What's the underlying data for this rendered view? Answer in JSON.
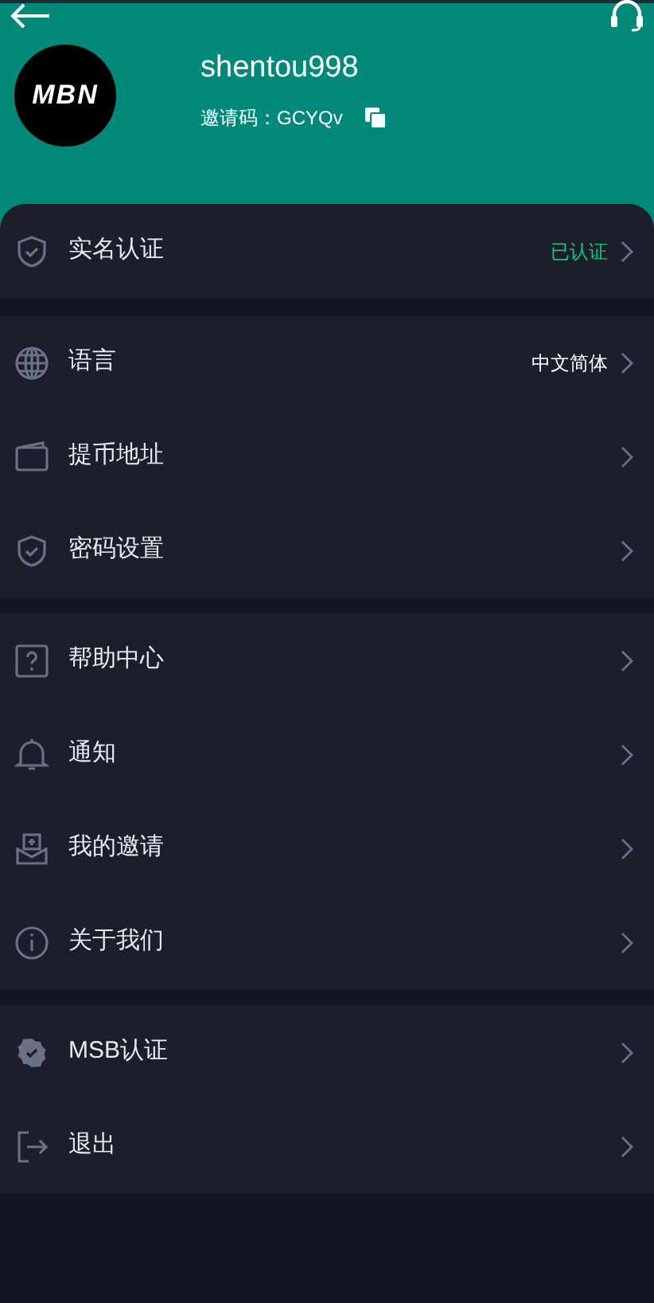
{
  "header": {
    "logo_text": "MBN",
    "username": "shentou998",
    "invite_label": "邀请码：",
    "invite_code": "GCYQv"
  },
  "groups": [
    {
      "items": [
        {
          "kind": "shield",
          "label": "实名认证",
          "value": {
            "text": "已认证",
            "color": "#19c37d"
          }
        }
      ]
    },
    {
      "items": [
        {
          "kind": "globe",
          "label": "语言",
          "value": {
            "text": "中文简体",
            "color": "#ffffff"
          }
        },
        {
          "kind": "wallet",
          "label": "提币地址"
        },
        {
          "kind": "shield",
          "label": "密码设置"
        }
      ]
    },
    {
      "items": [
        {
          "kind": "help",
          "label": "帮助中心"
        },
        {
          "kind": "bell",
          "label": "通知"
        },
        {
          "kind": "inbox",
          "label": "我的邀请"
        },
        {
          "kind": "info",
          "label": "关于我们"
        }
      ]
    },
    {
      "items": [
        {
          "kind": "badge",
          "label": "MSB认证"
        },
        {
          "kind": "exit",
          "label": "退出"
        }
      ]
    }
  ]
}
